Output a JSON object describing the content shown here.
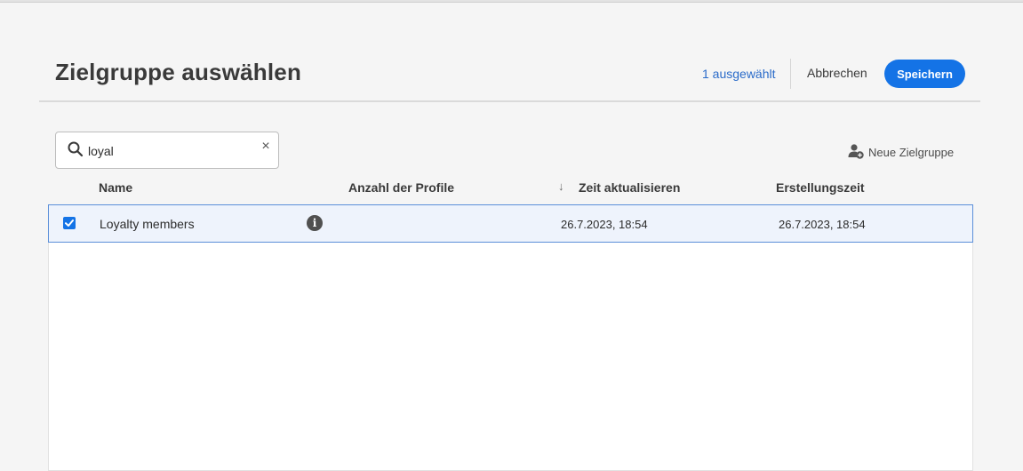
{
  "dialog": {
    "title": "Zielgruppe auswählen",
    "selected_count": "1 ausgewählt",
    "cancel_label": "Abbrechen",
    "save_label": "Speichern",
    "accent_color": "#1473e6"
  },
  "search": {
    "value": "loyal",
    "clear_symbol": "×"
  },
  "toolbar": {
    "new_audience_label": "Neue Zielgruppe",
    "new_audience_icon": "add-user-icon"
  },
  "table": {
    "columns": {
      "name": "Name",
      "profile_count": "Anzahl der Profile",
      "updated": "Zeit aktualisieren",
      "created": "Erstellungszeit"
    },
    "sort_symbol": "↓",
    "rows": [
      {
        "selected": true,
        "name": "Loyalty members",
        "info_symbol": "i",
        "profile_count": "",
        "updated": "26.7.2023, 18:54",
        "created": "26.7.2023, 18:54"
      }
    ]
  }
}
